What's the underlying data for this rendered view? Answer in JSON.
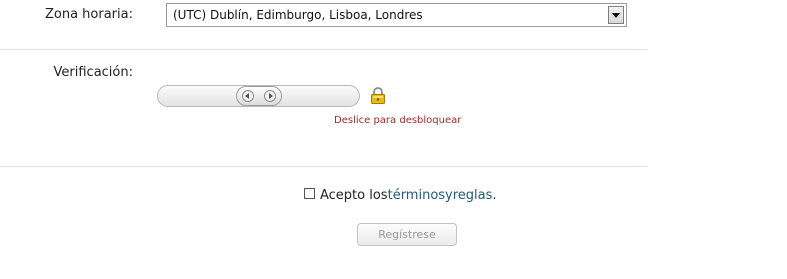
{
  "timezone": {
    "label": "Zona horaria:",
    "selected": "(UTC) Dublín, Edimburgo, Lisboa, Londres"
  },
  "verification": {
    "label": "Verificación:",
    "hint": "Deslice para desbloquear",
    "lock_icon": "lock-icon",
    "handle_icons": [
      "arrow-left-icon",
      "arrow-right-icon"
    ]
  },
  "terms": {
    "prefix": "Acepto los ",
    "link_terms": "términos",
    "connector": " y ",
    "link_rules": "reglas",
    "suffix": ".",
    "checked": false
  },
  "register": {
    "label": "Regístrese",
    "disabled": true
  },
  "colors": {
    "link": "#1f5d76",
    "hint": "#a52a2a",
    "divider": "#d9e8ee"
  }
}
